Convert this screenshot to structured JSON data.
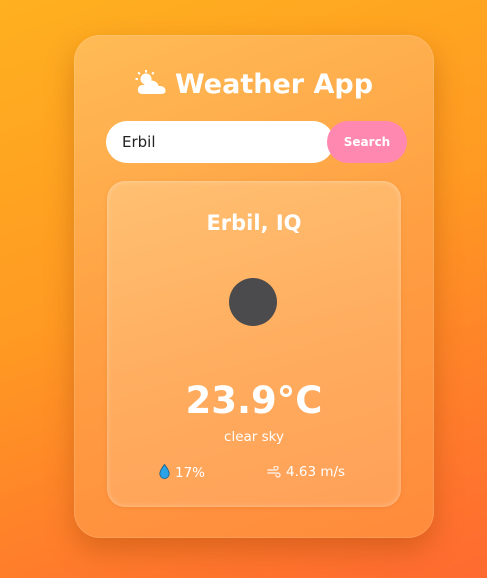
{
  "app": {
    "title": "Weather App",
    "title_icon": "sun-behind-cloud-icon"
  },
  "search": {
    "value": "Erbil",
    "button_label": "Search"
  },
  "weather": {
    "location": "Erbil, IQ",
    "icon": "weather-condition-icon",
    "temperature": "23.9°C",
    "description": "clear sky",
    "humidity": "17%",
    "humidity_icon": "droplet-icon",
    "wind": "4.63 m/s",
    "wind_icon": "wind-icon"
  },
  "colors": {
    "search_button": "#ff88b0",
    "weather_icon": "#4b4a4c",
    "humidity_icon": "#29a3e6"
  }
}
